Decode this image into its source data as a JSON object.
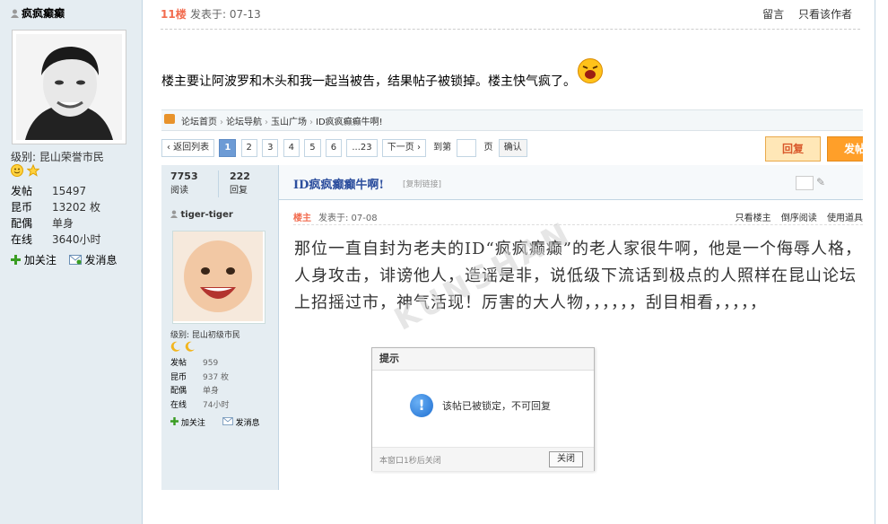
{
  "author": {
    "name": "疯疯癫癫",
    "level": "级别: 昆山荣誉市民",
    "stats": [
      {
        "label": "发帖",
        "value": "15497"
      },
      {
        "label": "昆币",
        "value": "13202 枚"
      },
      {
        "label": "配偶",
        "value": "单身"
      },
      {
        "label": "在线",
        "value": "3640小时"
      }
    ],
    "actions": {
      "follow": "加关注",
      "message": "发消息"
    }
  },
  "post": {
    "floor": "11楼",
    "posted": "发表于: 07-13",
    "links": {
      "reply": "留言",
      "only_author": "只看该作者"
    },
    "text": "楼主要让阿波罗和木头和我一起当被告，结果帖子被锁掉。楼主快气疯了。"
  },
  "shot": {
    "breadcrumb": [
      "论坛首页",
      "论坛导航",
      "玉山广场",
      "ID疯疯癫癫牛啊!"
    ],
    "pager": {
      "back": "‹ 返回列表",
      "pages": [
        "1",
        "2",
        "3",
        "4",
        "5",
        "6",
        "...23"
      ],
      "next": "下一页 ›",
      "goto": "到第",
      "page_unit": "页",
      "confirm": "确认"
    },
    "reply_btn": "回复",
    "post_btn": "发帖",
    "views": {
      "value": "7753",
      "label": "阅读"
    },
    "replies": {
      "value": "222",
      "label": "回复"
    },
    "thread_title": "ID疯疯癫癫牛啊!",
    "copy_link": "[复制链接]",
    "user": {
      "name": "tiger-tiger",
      "level": "级别: 昆山初级市民",
      "stats": [
        {
          "label": "发帖",
          "value": "959"
        },
        {
          "label": "昆币",
          "value": "937 枚"
        },
        {
          "label": "配偶",
          "value": "单身"
        },
        {
          "label": "在线",
          "value": "74小时"
        }
      ],
      "follow": "加关注",
      "message": "发消息"
    },
    "op": {
      "floor": "楼主",
      "posted": "发表于: 07-08",
      "links": [
        "只看楼主",
        "倒序阅读",
        "使用道具"
      ],
      "body": "那位一直自封为老夫的ID“疯疯癫癫”的老人家很牛啊，他是一个侮辱人格，人身攻击，诽谤他人，造谣是非，说低级下流话到极点的人照样在昆山论坛上招摇过市，神气活现！厉害的大人物，，，，，，刮目相看，，，，，"
    },
    "watermark": "KUNSHAN",
    "dialog": {
      "title": "提示",
      "icon": "!",
      "message": "该帖已被锁定，不可回复",
      "countdown": "本窗口1秒后关闭",
      "close": "关闭"
    }
  }
}
